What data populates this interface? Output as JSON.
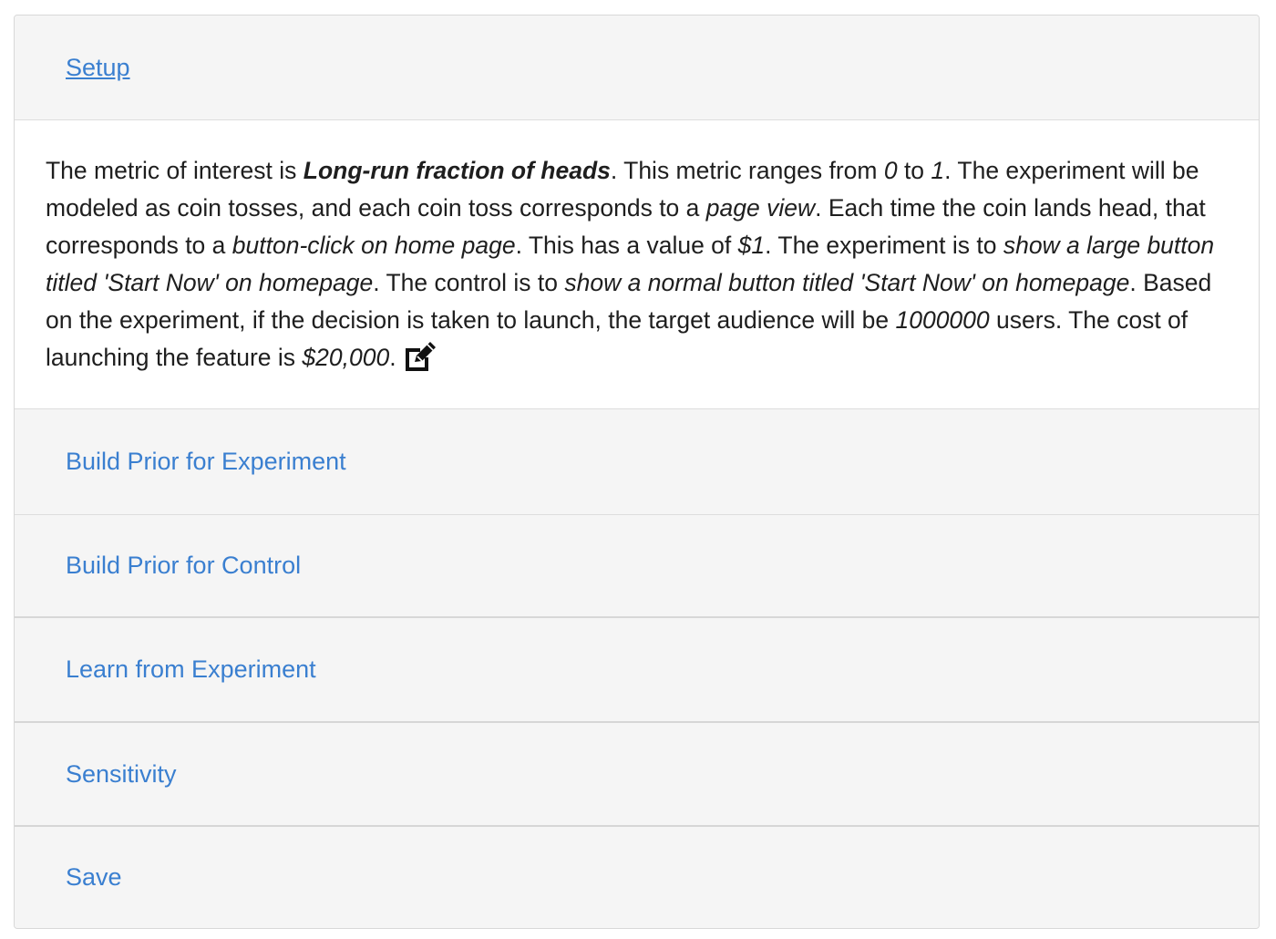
{
  "sections": {
    "setup": {
      "label": "Setup"
    },
    "build_prior_experiment": {
      "label": "Build Prior for Experiment"
    },
    "build_prior_control": {
      "label": "Build Prior for Control"
    },
    "learn_from_experiment": {
      "label": "Learn from Experiment"
    },
    "sensitivity": {
      "label": "Sensitivity"
    },
    "save": {
      "label": "Save"
    }
  },
  "setup_body": {
    "t1": "The metric of interest is ",
    "metric_name": "Long-run fraction of heads",
    "t2": ". This metric ranges from ",
    "range_min": "0",
    "t3": " to ",
    "range_max": "1",
    "t4": ". The experiment will be modeled as coin tosses, and each coin toss corresponds to a ",
    "unit": "page view",
    "t5": ". Each time the coin lands head, that corresponds to a ",
    "event": "button-click on home page",
    "t6": ". This has a value of ",
    "value": "$1",
    "t7": ". The experiment is to ",
    "experiment_desc": "show a large button titled 'Start Now' on homepage",
    "t8": ". The control is to ",
    "control_desc": "show a normal button titled 'Start Now' on homepage",
    "t9": ". Based on the experiment, if the decision is taken to launch, the target audience will be ",
    "audience": "1000000",
    "t10": " users. The cost of launching the feature is ",
    "cost": "$20,000",
    "t11": ".",
    "edit_icon": "edit-pencil-square-icon"
  },
  "colors": {
    "link": "#3a7fd0",
    "heading_bg": "#f5f5f5",
    "body_bg": "#ffffff",
    "border": "#dddddd"
  }
}
